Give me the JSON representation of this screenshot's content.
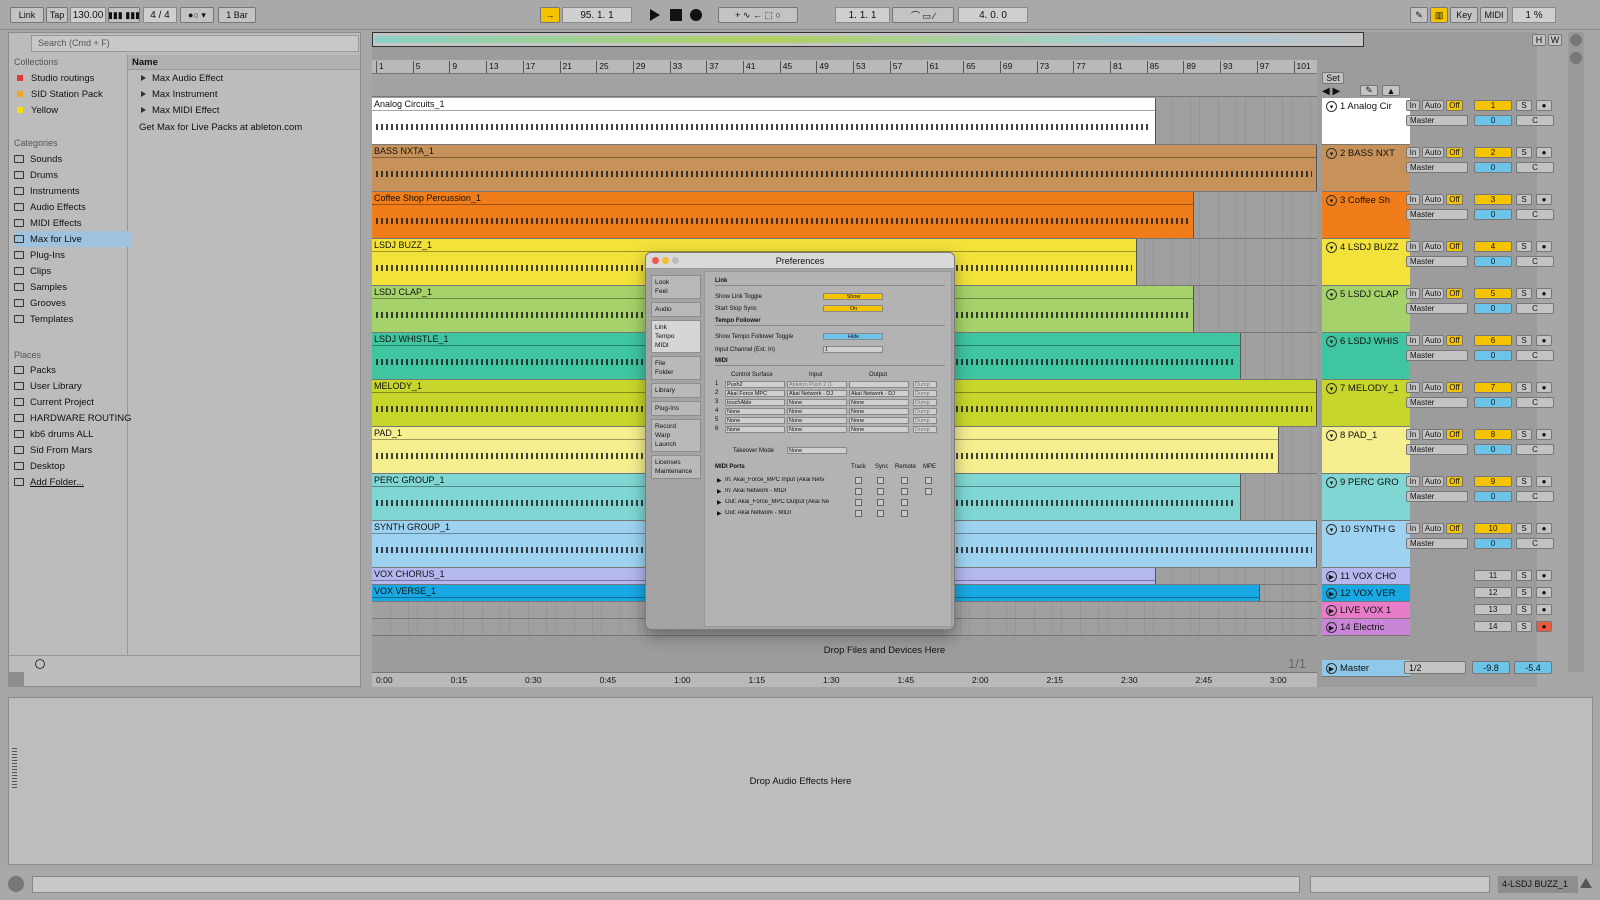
{
  "topbar": {
    "link": "Link",
    "tap": "Tap",
    "tempo": "130.00",
    "meter": "4 / 4",
    "quant": "1 Bar",
    "position": "95.  1.  1",
    "loop_start": "1.  1.  1",
    "loop_len": "4.  0.  0",
    "key": "Key",
    "midi": "MIDI",
    "cpu": "1 %"
  },
  "browser": {
    "search_placeholder": "Search (Cmd + F)",
    "collections_header": "Collections",
    "collections": [
      {
        "label": "Studio routings",
        "color": "#e53935"
      },
      {
        "label": "SID Station Pack",
        "color": "#f5a623"
      },
      {
        "label": "Yellow",
        "color": "#f5e000"
      }
    ],
    "categories_header": "Categories",
    "categories": [
      "Sounds",
      "Drums",
      "Instruments",
      "Audio Effects",
      "MIDI Effects",
      "Max for Live",
      "Plug-Ins",
      "Clips",
      "Samples",
      "Grooves",
      "Templates"
    ],
    "places_header": "Places",
    "places": [
      "Packs",
      "User Library",
      "Current Project",
      "HARDWARE ROUTING",
      "kb6 drums ALL",
      "Sid From Mars",
      "Desktop",
      "Add Folder..."
    ],
    "name_header": "Name",
    "names": [
      "Max Audio Effect",
      "Max Instrument",
      "Max MIDI Effect"
    ],
    "get_packs": "Get Max for Live Packs at ableton.com"
  },
  "ruler": {
    "bars": [
      "1",
      "5",
      "9",
      "13",
      "17",
      "21",
      "25",
      "29",
      "33",
      "37",
      "41",
      "45",
      "49",
      "53",
      "57",
      "61",
      "65",
      "69",
      "73",
      "77",
      "81",
      "85",
      "89",
      "93",
      "97",
      "101"
    ],
    "times": [
      "0:00",
      "0:15",
      "0:30",
      "0:45",
      "1:00",
      "1:15",
      "1:30",
      "1:45",
      "2:00",
      "2:15",
      "2:30",
      "2:45",
      "3:00"
    ],
    "set": "Set",
    "page": "1/1"
  },
  "tracks": [
    {
      "clip": "Analog Circuits_1",
      "name": "1 Analog Cir",
      "num": "1",
      "color": "#ffffff",
      "end": 0.83,
      "h": 47
    },
    {
      "clip": "BASS NXTA_1",
      "name": "2 BASS NXT",
      "num": "2",
      "color": "#c7925a",
      "end": 1.0,
      "h": 47
    },
    {
      "clip": "Coffee Shop Percussion_1",
      "name": "3 Coffee Sh",
      "num": "3",
      "color": "#f07d1a",
      "end": 0.87,
      "h": 47
    },
    {
      "clip": "LSDJ BUZZ_1",
      "name": "4 LSDJ BUZZ",
      "num": "4",
      "color": "#f2e23a",
      "end": 0.81,
      "h": 47
    },
    {
      "clip": "LSDJ CLAP_1",
      "name": "5 LSDJ CLAP",
      "num": "5",
      "color": "#a5d26a",
      "end": 0.87,
      "h": 47
    },
    {
      "clip": "LSDJ WHISTLE_1",
      "name": "6 LSDJ WHIS",
      "num": "6",
      "color": "#3fc5a0",
      "end": 0.92,
      "h": 47
    },
    {
      "clip": "MELODY_1",
      "name": "7 MELODY_1",
      "num": "7",
      "color": "#c6d62a",
      "end": 1.0,
      "h": 47
    },
    {
      "clip": "PAD_1",
      "name": "8 PAD_1",
      "num": "8",
      "color": "#f5ef8f",
      "end": 0.96,
      "h": 47
    },
    {
      "clip": "PERC GROUP_1",
      "name": "9 PERC GRO",
      "num": "9",
      "color": "#7fd6d2",
      "end": 0.92,
      "h": 47
    },
    {
      "clip": "SYNTH GROUP_1",
      "name": "10 SYNTH G",
      "num": "10",
      "color": "#9dd3f0",
      "end": 1.0,
      "h": 47
    },
    {
      "clip": "VOX CHORUS_1",
      "name": "11 VOX CHO",
      "num": "11",
      "color": "#b5b7ef",
      "end": 0.83,
      "h": 17
    },
    {
      "clip": "VOX VERSE_1",
      "name": "12 VOX VER",
      "num": "12",
      "color": "#18a8e3",
      "end": 0.94,
      "h": 17
    },
    {
      "clip": "",
      "name": "LIVE VOX 1",
      "num": "13",
      "color": "#e87cc9",
      "end": 0,
      "h": 17
    },
    {
      "clip": "",
      "name": "14 Electric",
      "num": "14",
      "color": "#c986d8",
      "end": 0,
      "h": 17
    }
  ],
  "mixer": {
    "in": "In",
    "auto": "Auto",
    "off": "Off",
    "master_out": "Master",
    "zero": "0",
    "center": "C",
    "solo": "S"
  },
  "drop_devices": "Drop Files and Devices Here",
  "master": {
    "name": "Master",
    "out": "1/2",
    "vol": "-9.8",
    "pan": "-5.4"
  },
  "prefs": {
    "title": "Preferences",
    "tabs": [
      [
        "Look",
        "Feel"
      ],
      [
        "Audio"
      ],
      [
        "Link",
        "Tempo",
        "MIDI"
      ],
      [
        "File",
        "Folder"
      ],
      [
        "Library"
      ],
      [
        "Plug-Ins"
      ],
      [
        "Record",
        "Warp",
        "Launch"
      ],
      [
        "Licenses",
        "Maintenance"
      ]
    ],
    "link_header": "Link",
    "show_link_toggle": "Show Link Toggle",
    "show_btn": "Show",
    "start_stop": "Start Stop Sync",
    "on_btn": "On",
    "tempo_header": "Tempo Follower",
    "tempo_toggle": "Show Tempo Follower Toggle",
    "hide_btn": "Hide",
    "input_channel": "Input Channel (Ext. In)",
    "input_channel_val": "1",
    "midi_header": "MIDI",
    "cs_header": "Control Surface",
    "in_header": "Input",
    "out_header": "Output",
    "surfaces": [
      {
        "n": "1",
        "cs": "Push2",
        "in": "Ableton Push 2 (L",
        "out": "",
        "dump": "Dump"
      },
      {
        "n": "2",
        "cs": "Akai Force MPC",
        "in": "Akai Network - DJ",
        "out": "Akai Network - DJ",
        "dump": "Dump"
      },
      {
        "n": "3",
        "cs": "touchAble",
        "in": "None",
        "out": "None",
        "dump": "Dump"
      },
      {
        "n": "4",
        "cs": "None",
        "in": "None",
        "out": "None",
        "dump": "Dump"
      },
      {
        "n": "5",
        "cs": "None",
        "in": "None",
        "out": "None",
        "dump": "Dump"
      },
      {
        "n": "6",
        "cs": "None",
        "in": "None",
        "out": "None",
        "dump": "Dump"
      }
    ],
    "takeover": "Takeover Mode",
    "takeover_val": "None",
    "ports_header": "MIDI Ports",
    "track": "Track",
    "sync": "Sync",
    "remote": "Remote",
    "mpe": "MPE",
    "ports": [
      "In:   Akai_Force_MPC Input (Akai Netv",
      "In:   Akai Network - MIDI",
      "Out:  Akai_Force_MPC Output (Akai Ne",
      "Out:  Akai Network - MIDI"
    ]
  },
  "drop_effects": "Drop Audio Effects Here",
  "status_clip": "4-LSDJ BUZZ_1"
}
